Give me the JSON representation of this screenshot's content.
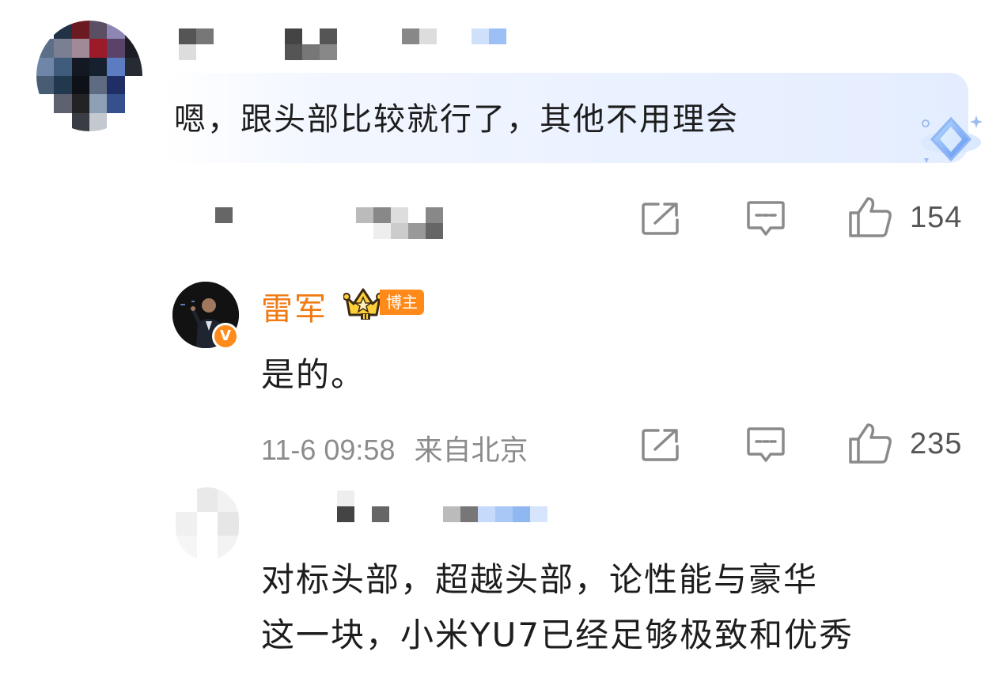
{
  "comments": [
    {
      "username_redacted": true,
      "text": "嗯，跟头部比较就行了，其他不用理会",
      "meta_redacted": true,
      "like_count": "154"
    },
    {
      "username": "雷军",
      "role_tag": "博主",
      "verified_badge": "V",
      "text": "是的。",
      "timestamp": "11-6 09:58",
      "location": "来自北京",
      "like_count": "235"
    },
    {
      "username_redacted": true,
      "text_line1": "对标头部，超越头部，论性能与豪华",
      "text_line2": "这一块，小米YU7已经足够极致和优秀"
    }
  ],
  "icons": {
    "share": "share-icon",
    "reply": "comment-icon",
    "like": "thumbs-up-icon"
  },
  "colors": {
    "accent_orange": "#f07a13",
    "meta_gray": "#8c8c8c",
    "icon_gray": "#8a8a8a",
    "bubble_blue": "#eaf1ff"
  }
}
